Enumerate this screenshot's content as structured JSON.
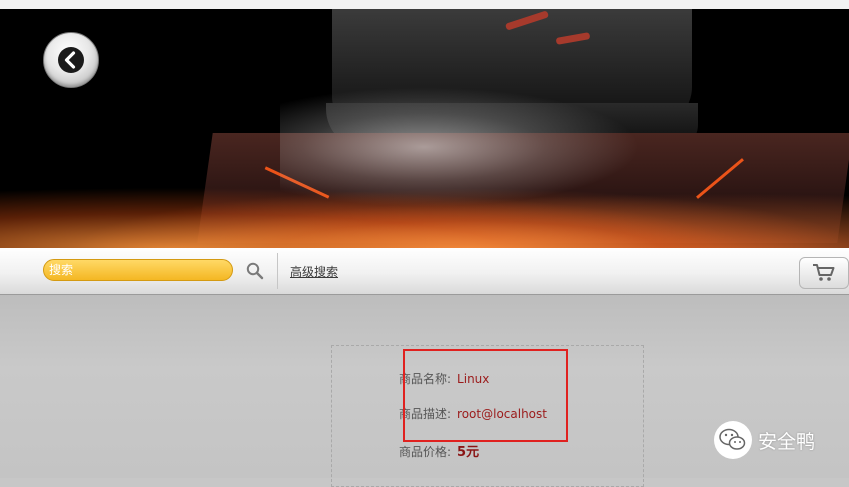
{
  "hero": {
    "back_button_icon": "chevron-left-icon"
  },
  "searchbar": {
    "search_value": "搜索",
    "search_icon": "search-icon",
    "advanced_search_label": "高级搜索",
    "cart_icon": "cart-icon"
  },
  "product": {
    "name_label": "商品名称:",
    "name_value": "Linux",
    "desc_label": "商品描述:",
    "desc_value": "root@localhost",
    "price_label": "商品价格:",
    "price_value": "5元"
  },
  "watermark": {
    "text": "安全鸭"
  },
  "colors": {
    "accent_yellow": "#f4b723",
    "value_red": "#9b1b1b",
    "highlight_border": "#e0211f"
  }
}
